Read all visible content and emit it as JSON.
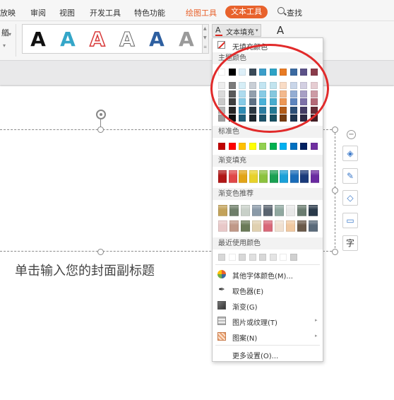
{
  "menubar": {
    "items": [
      {
        "label": "放映"
      },
      {
        "label": "审阅"
      },
      {
        "label": "视图"
      },
      {
        "label": "开发工具"
      },
      {
        "label": "特色功能"
      },
      {
        "label": "绘图工具"
      },
      {
        "label": "文本工具"
      }
    ],
    "search_label": "查找",
    "draw_tools_color": "#e8622c",
    "active_tab_color": "#e8622c"
  },
  "ribbon": {
    "left_fragment": "艏",
    "text_fill_label": "文本填充",
    "art_styles": [
      {
        "style": "solid-black"
      },
      {
        "style": "solid-teal"
      },
      {
        "style": "outline-red"
      },
      {
        "style": "outline-gray"
      },
      {
        "style": "solid-blue"
      },
      {
        "style": "gradient-gray"
      }
    ]
  },
  "slide": {
    "subtitle": "单击输入您的封面副标题"
  },
  "dropdown": {
    "no_fill": "无填充颜色",
    "theme_colors_title": "主题颜色",
    "standard_colors_title": "标准色",
    "gradient_fill_title": "渐变填充",
    "gradient_recommend_title": "渐变色推荐",
    "recent_colors_title": "最近使用颜色",
    "theme_colors": [
      [
        "#ffffff",
        "#000000",
        "#e7e6e6",
        "#44546a",
        "#3d8fb8",
        "#ed7d31",
        "#a5a5a5",
        "#ffc000",
        "#4472c4",
        "#70ad47"
      ],
      [
        "#f2f2f2",
        "#7f7f7f",
        "#d0cece",
        "#d6dce4",
        "#c5e6f1",
        "#fbe5d6",
        "#ededed",
        "#fff2cc",
        "#dae3f3",
        "#e2f0d9"
      ],
      [
        "#d9d9d9",
        "#595959",
        "#aeabab",
        "#adb9ca",
        "#8ccbe3",
        "#f8cbad",
        "#dbdbdb",
        "#ffe699",
        "#b4c7e7",
        "#c5e0b4"
      ],
      [
        "#bfbfbf",
        "#3f3f3f",
        "#757171",
        "#8497b0",
        "#4eaed3",
        "#f4b183",
        "#c9c9c9",
        "#ffd966",
        "#8faadc",
        "#a9d18e"
      ],
      [
        "#a6a6a6",
        "#262626",
        "#3a3838",
        "#333f50",
        "#21789c",
        "#c55a11",
        "#7b7b7b",
        "#bf9000",
        "#2f5597",
        "#548235"
      ],
      [
        "#7f7f7f",
        "#0d0d0d",
        "#171616",
        "#222a35",
        "#165068",
        "#843c0c",
        "#525252",
        "#7f6000",
        "#1f3864",
        "#385723"
      ]
    ],
    "theme_header_row": [
      "#ffffff",
      "#000000",
      "#ddeff8",
      "#3a4a58",
      "#3c9ec9",
      "#2ea3c6",
      "#e87b24",
      "#3b6aa0",
      "#5c5288",
      "#8a3c4b"
    ],
    "theme_grid": [
      [
        "#ededed",
        "#7b7b7b",
        "#d6eef7",
        "#c9cfd6",
        "#c3e5f2",
        "#c2e4ef",
        "#f9dcc6",
        "#c9d6e9",
        "#d3cfe2",
        "#e6cdd2"
      ],
      [
        "#dbdbdb",
        "#5a5a5a",
        "#aedcef",
        "#93a0ad",
        "#87cbe5",
        "#85c8df",
        "#f3b98d",
        "#93add3",
        "#a8a0c5",
        "#cd9ba5"
      ],
      [
        "#c9c9c9",
        "#3f3f3f",
        "#86cbe7",
        "#5e7184",
        "#4ab1d8",
        "#48adcf",
        "#ed9755",
        "#5d85be",
        "#7d71a8",
        "#b46a78"
      ],
      [
        "#b5b5b5",
        "#262626",
        "#2f8db5",
        "#2c3842",
        "#2d7ea2",
        "#237a95",
        "#b45c18",
        "#2c5078",
        "#453d66",
        "#682d38"
      ],
      [
        "#a0a0a0",
        "#0f0f0f",
        "#1f5e79",
        "#1d252c",
        "#1e546c",
        "#175163",
        "#783d10",
        "#1d3550",
        "#2e2944",
        "#451e25"
      ]
    ],
    "standard_colors": [
      "#c00000",
      "#ff0000",
      "#ffc000",
      "#ffff00",
      "#92d050",
      "#00b050",
      "#00b0f0",
      "#0070c0",
      "#002060",
      "#7030a0"
    ],
    "gradient_fill": [
      "#b01616",
      "#e04848",
      "#e2a418",
      "#e8d22a",
      "#8cc23e",
      "#1aa052",
      "#1aa0d8",
      "#1a6cb8",
      "#1a3a7a",
      "#6a2aa0"
    ],
    "gradient_recommend_row1": [
      "#c2a25a",
      "#6f7f6a",
      "#c8d0c8",
      "#8a9aa8",
      "#5a6470",
      "#90a8a0",
      "#e8e8e8",
      "#6a7c70",
      "#2a3a4a"
    ],
    "gradient_recommend_row2": [
      "#e8c8c8",
      "#c09888",
      "#6a7a58",
      "#e0d0b0",
      "#d86878",
      "#f0e0d0",
      "#f0c8a0",
      "#6a5a4a",
      "#5a6a7a"
    ],
    "recent_colors": [
      "#d8d8d8",
      "#ffffff",
      "#d8d8d8",
      "#e0e0e0",
      "#d8d8d8",
      "#e4e4e4",
      "#ffffff",
      "#d0d0d0"
    ],
    "menu_items": [
      {
        "label": "其他字体颜色(M)...",
        "icon": "color-palette-icon",
        "submenu": false
      },
      {
        "label": "取色器(E)",
        "icon": "eyedropper-icon",
        "submenu": false
      },
      {
        "label": "渐变(G)",
        "icon": "gradient-icon",
        "submenu": false
      },
      {
        "label": "图片或纹理(T)",
        "icon": "picture-icon",
        "submenu": true
      },
      {
        "label": "图案(N)",
        "icon": "pattern-icon",
        "submenu": true
      },
      {
        "label": "更多设置(O)...",
        "icon": "",
        "submenu": false
      }
    ],
    "annotation_color": "#e12a2a"
  }
}
